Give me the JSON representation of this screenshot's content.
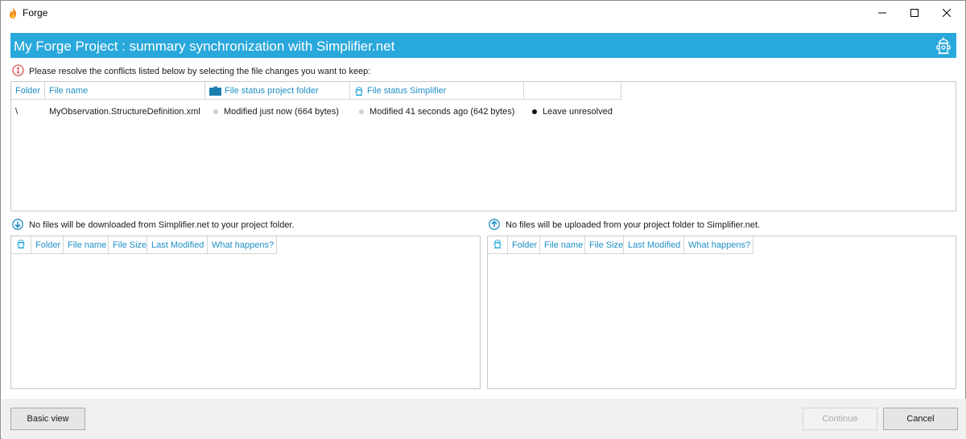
{
  "window": {
    "title": "Forge"
  },
  "banner": {
    "title": "My Forge Project : summary synchronization with Simplifier.net"
  },
  "conflicts": {
    "message": "Please resolve the conflicts listed below by selecting the file changes you want to keep:",
    "columns": [
      "Folder",
      "File name",
      "File status project folder",
      "File status Simplifier",
      ""
    ],
    "rows": [
      {
        "folder": "\\",
        "file_name": "MyObservation.StructureDefinition.xml",
        "status_project": "Modified just now (664 bytes)",
        "status_simplifier": "Modified 41 seconds ago (642 bytes)",
        "resolution": "Leave unresolved"
      }
    ]
  },
  "download": {
    "message": "No files will be downloaded from Simplifier.net to your project folder.",
    "columns": [
      "Folder",
      "File name",
      "File Size",
      "Last Modified",
      "What happens?"
    ]
  },
  "upload": {
    "message": "No files will be uploaded from your project folder to Simplifier.net.",
    "columns": [
      "Folder",
      "File name",
      "File Size",
      "Last Modified",
      "What happens?"
    ]
  },
  "footer": {
    "basic_view": "Basic view",
    "continue": "Continue",
    "cancel": "Cancel"
  },
  "colors": {
    "accent": "#29a8dc",
    "header_text": "#1f8fc6",
    "conflict_icon": "#d9534f"
  },
  "icons": {
    "app": "flame-icon",
    "banner": "fire-hydrant-icon",
    "conflict": "conflict-warning-icon",
    "download": "download-arrow-icon",
    "upload": "upload-arrow-icon"
  }
}
